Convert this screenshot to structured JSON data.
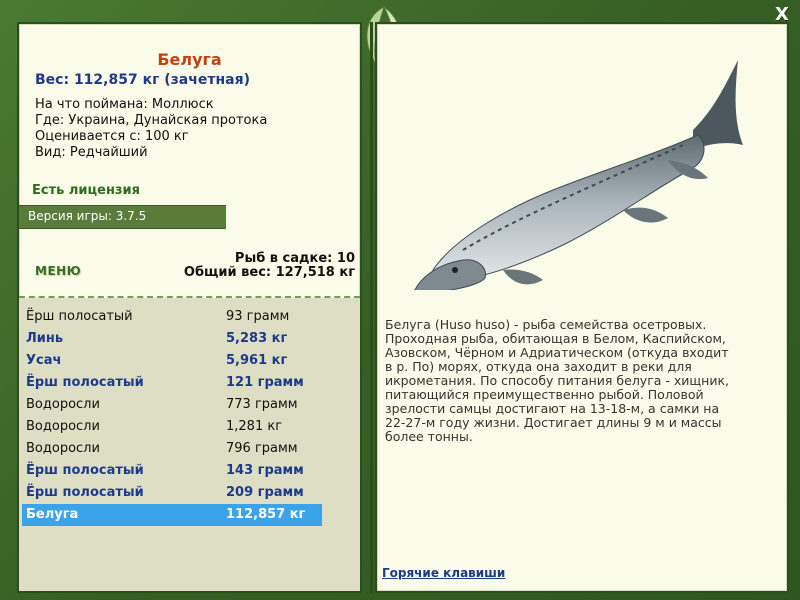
{
  "fish": {
    "name": "Белуга",
    "weight_line": "Вес: 112,857 кг (зачетная)",
    "caught_with": "На что поймана: Моллюск",
    "location": "Где: Украина, Дунайская протока",
    "valued_from": "Оценивается с: 100 кг",
    "rarity": "Вид: Редчайший",
    "license": "Есть лицензия"
  },
  "version": "Версия игры: 3.7.5",
  "menu_label": "МЕНЮ",
  "summary": {
    "fish_count": "Рыб в садке: 10",
    "total_weight": "Общий вес: 127,518 кг"
  },
  "catch_list": [
    {
      "name": "Ёрш полосатый",
      "weight": "93 грамм",
      "style": "normal"
    },
    {
      "name": "Линь",
      "weight": "5,283 кг",
      "style": "bold"
    },
    {
      "name": "Усач",
      "weight": "5,961 кг",
      "style": "bold"
    },
    {
      "name": "Ёрш полосатый",
      "weight": "121 грамм",
      "style": "bold"
    },
    {
      "name": "Водоросли",
      "weight": "773 грамм",
      "style": "normal"
    },
    {
      "name": "Водоросли",
      "weight": "1,281 кг",
      "style": "normal"
    },
    {
      "name": "Водоросли",
      "weight": "796 грамм",
      "style": "normal"
    },
    {
      "name": "Ёрш полосатый",
      "weight": "143 грамм",
      "style": "bold"
    },
    {
      "name": "Ёрш полосатый",
      "weight": "209 грамм",
      "style": "bold"
    },
    {
      "name": "Белуга",
      "weight": "112,857 кг",
      "style": "selected"
    }
  ],
  "description": "Белуга (Huso huso) - рыба семейства осетровых. Проходная рыба, обитающая в Белом, Каспийском, Азовском, Чёрном и Адриатическом (откуда входит в р. По) морях, откуда она заходит в реки для икрометания. По способу питания белуга - хищник, питающийся преимущественно рыбой. Половой зрелости самцы достигают на 13-18-м, а самки на 22-27-м году жизни. Достигает длины 9 м и массы более тонны.",
  "hotkeys_label": "Горячие клавиши",
  "close_label": "X",
  "colors": {
    "background": "#3e6a2a",
    "panel": "#fbfbe9",
    "title": "#c2410c",
    "accent_blue": "#1e3a8a",
    "selected_row": "#3aa3ea",
    "version_bar": "#5a7c3a"
  },
  "icons": [
    "leaf-ornament-icon",
    "close-icon",
    "beluga-fish-image"
  ]
}
